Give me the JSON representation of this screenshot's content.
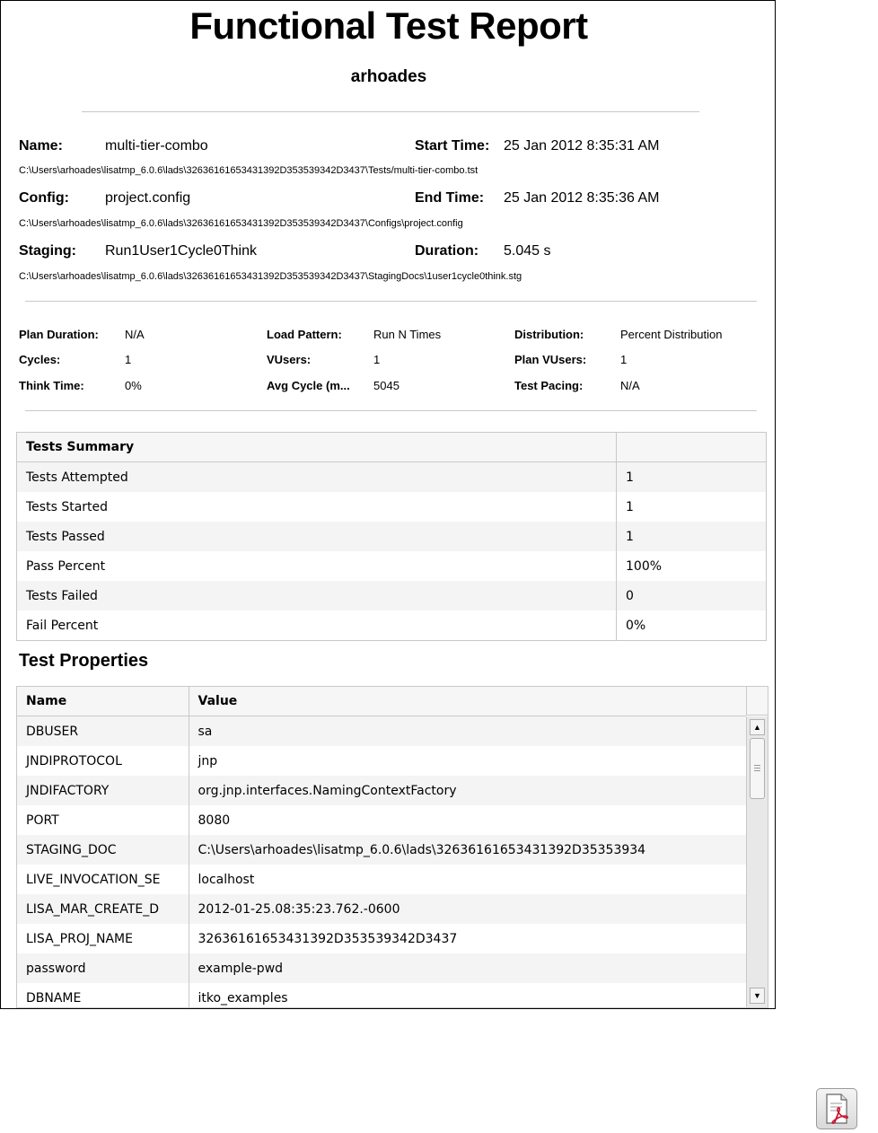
{
  "report": {
    "title": "Functional Test Report",
    "user": "arhoades",
    "name_label": "Name:",
    "name_value": "multi-tier-combo",
    "name_path": "C:\\Users\\arhoades\\lisatmp_6.0.6\\lads\\32636161653431392D353539342D3437\\Tests/multi-tier-combo.tst",
    "config_label": "Config:",
    "config_value": "project.config",
    "config_path": "C:\\Users\\arhoades\\lisatmp_6.0.6\\lads\\32636161653431392D353539342D3437\\Configs\\project.config",
    "staging_label": "Staging:",
    "staging_value": "Run1User1Cycle0Think",
    "staging_path": "C:\\Users\\arhoades\\lisatmp_6.0.6\\lads\\32636161653431392D353539342D3437\\StagingDocs\\1user1cycle0think.stg",
    "start_label": "Start Time:",
    "start_value": "25 Jan 2012 8:35:31 AM",
    "end_label": "End Time:",
    "end_value": "25 Jan 2012 8:35:36 AM",
    "duration_label": "Duration:",
    "duration_value": "5.045 s"
  },
  "params": {
    "plan_duration_label": "Plan Duration:",
    "plan_duration_value": "N/A",
    "cycles_label": "Cycles:",
    "cycles_value": "1",
    "think_label": "Think Time:",
    "think_value": "0%",
    "load_label": "Load Pattern:",
    "load_value": "Run N Times",
    "vusers_label": "VUsers:",
    "vusers_value": "1",
    "avgcycle_label": "Avg Cycle (m...",
    "avgcycle_value": "5045",
    "distribution_label": "Distribution:",
    "distribution_value": "Percent Distribution",
    "plan_vusers_label": "Plan VUsers:",
    "plan_vusers_value": "1",
    "pacing_label": "Test Pacing:",
    "pacing_value": "N/A"
  },
  "summary": {
    "header": "Tests Summary",
    "rows": [
      {
        "label": "Tests Attempted",
        "value": "1"
      },
      {
        "label": "Tests Started",
        "value": "1"
      },
      {
        "label": "Tests Passed",
        "value": "1"
      },
      {
        "label": "Pass Percent",
        "value": "100%"
      },
      {
        "label": "Tests Failed",
        "value": "0"
      },
      {
        "label": "Fail Percent",
        "value": "0%"
      }
    ]
  },
  "properties": {
    "title": "Test Properties",
    "col_name": "Name",
    "col_value": "Value",
    "rows": [
      {
        "name": "DBUSER",
        "value": "sa"
      },
      {
        "name": "JNDIPROTOCOL",
        "value": "jnp"
      },
      {
        "name": "JNDIFACTORY",
        "value": "org.jnp.interfaces.NamingContextFactory"
      },
      {
        "name": "PORT",
        "value": "8080"
      },
      {
        "name": "STAGING_DOC",
        "value": "C:\\Users\\arhoades\\lisatmp_6.0.6\\lads\\32636161653431392D35353934"
      },
      {
        "name": "LIVE_INVOCATION_SE",
        "value": "localhost"
      },
      {
        "name": "LISA_MAR_CREATE_D",
        "value": "2012-01-25.08:35:23.762.-0600"
      },
      {
        "name": "LISA_PROJ_NAME",
        "value": "32636161653431392D353539342D3437"
      },
      {
        "name": "password",
        "value": "example-pwd"
      },
      {
        "name": "DBNAME",
        "value": "itko_examples"
      }
    ]
  },
  "icons": {
    "scroll_up": "▲",
    "scroll_down": "▼",
    "pdf": "pdf-export-icon"
  }
}
